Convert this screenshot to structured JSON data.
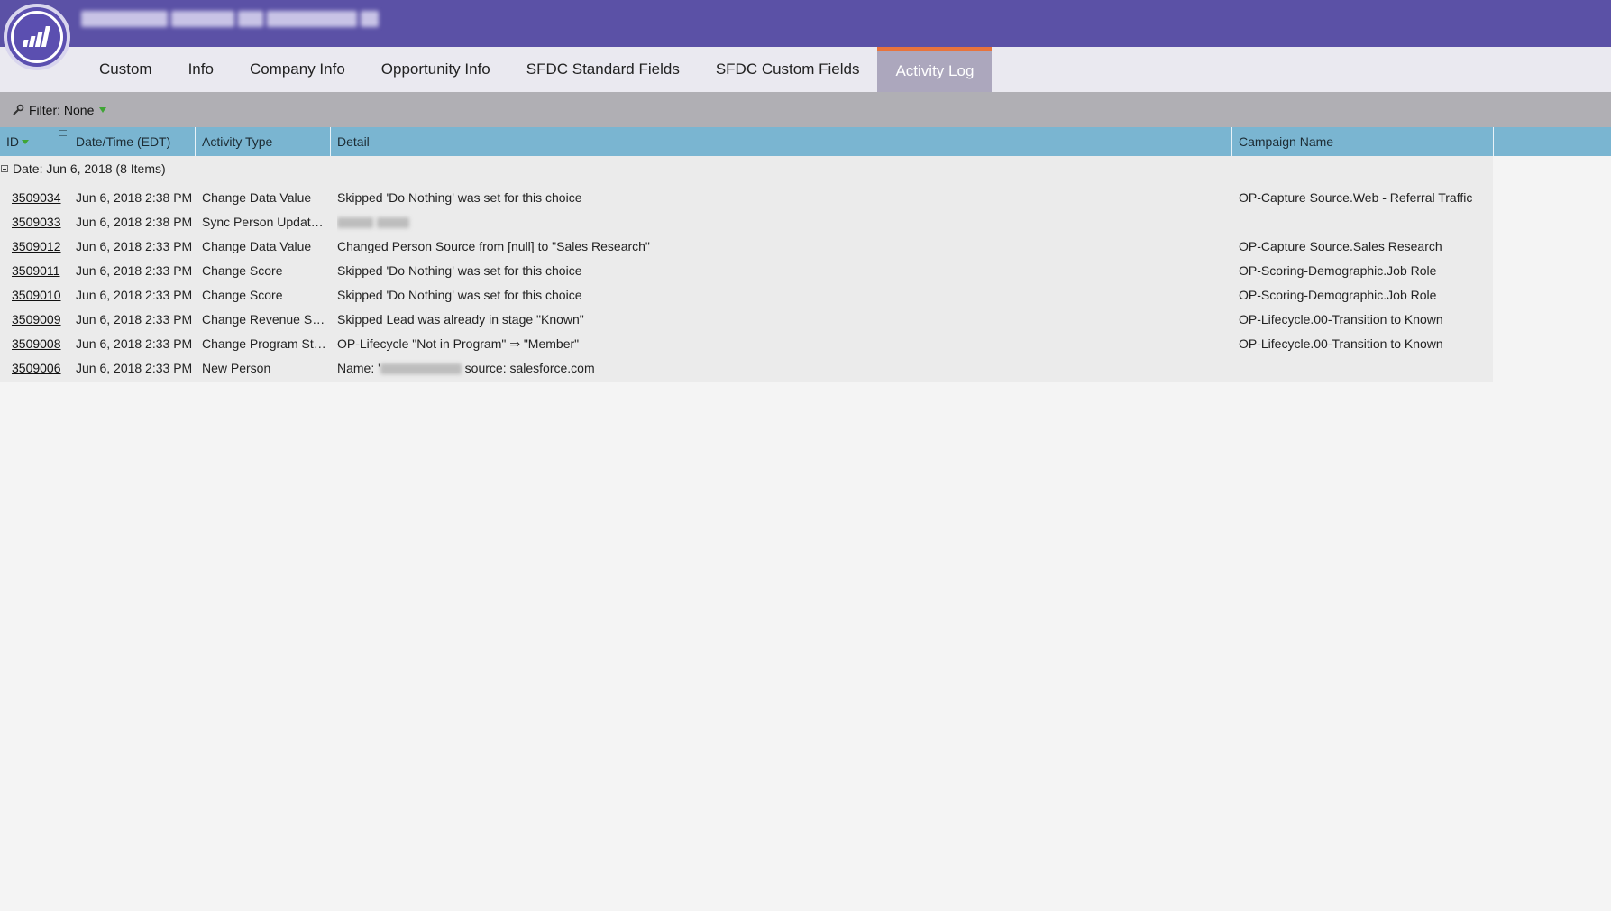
{
  "tabs": [
    "Custom",
    "Info",
    "Company Info",
    "Opportunity Info",
    "SFDC Standard Fields",
    "SFDC Custom Fields",
    "Activity Log"
  ],
  "active_tab": "Activity Log",
  "filter": {
    "label": "Filter: None"
  },
  "columns": {
    "id": "ID",
    "datetime": "Date/Time (EDT)",
    "activity_type": "Activity Type",
    "detail": "Detail",
    "campaign": "Campaign Name"
  },
  "group": {
    "label": "Date: Jun 6, 2018 (8 Items)"
  },
  "rows": [
    {
      "id": "3509034",
      "datetime": "Jun 6, 2018 2:38 PM",
      "type": "Change Data Value",
      "detail": "Skipped 'Do Nothing' was set for this choice",
      "campaign": "OP-Capture Source.Web - Referral Traffic"
    },
    {
      "id": "3509033",
      "datetime": "Jun 6, 2018 2:38 PM",
      "type": "Sync Person Update...",
      "detail": "",
      "campaign": ""
    },
    {
      "id": "3509012",
      "datetime": "Jun 6, 2018 2:33 PM",
      "type": "Change Data Value",
      "detail": "Changed Person Source from [null] to \"Sales Research\"",
      "campaign": "OP-Capture Source.Sales Research"
    },
    {
      "id": "3509011",
      "datetime": "Jun 6, 2018 2:33 PM",
      "type": "Change Score",
      "detail": "Skipped 'Do Nothing' was set for this choice",
      "campaign": "OP-Scoring-Demographic.Job Role"
    },
    {
      "id": "3509010",
      "datetime": "Jun 6, 2018 2:33 PM",
      "type": "Change Score",
      "detail": "Skipped 'Do Nothing' was set for this choice",
      "campaign": "OP-Scoring-Demographic.Job Role"
    },
    {
      "id": "3509009",
      "datetime": "Jun 6, 2018 2:33 PM",
      "type": "Change Revenue Sta...",
      "detail": "Skipped Lead was already in stage \"Known\"",
      "campaign": "OP-Lifecycle.00-Transition to Known"
    },
    {
      "id": "3509008",
      "datetime": "Jun 6, 2018 2:33 PM",
      "type": "Change Program Sta...",
      "detail": "OP-Lifecycle \"Not in Program\" ⇒ \"Member\"",
      "campaign": "OP-Lifecycle.00-Transition to Known"
    },
    {
      "id": "3509006",
      "datetime": "Jun 6, 2018 2:33 PM",
      "type": "New Person",
      "detail_prefix": "Name: '",
      "detail_suffix": " source: salesforce.com",
      "campaign": ""
    }
  ],
  "colors": {
    "header": "#5b51a6",
    "active_tab_accent": "#e8733c",
    "grid_header": "#7ab5d1",
    "filter_arrow": "#3fa535"
  }
}
